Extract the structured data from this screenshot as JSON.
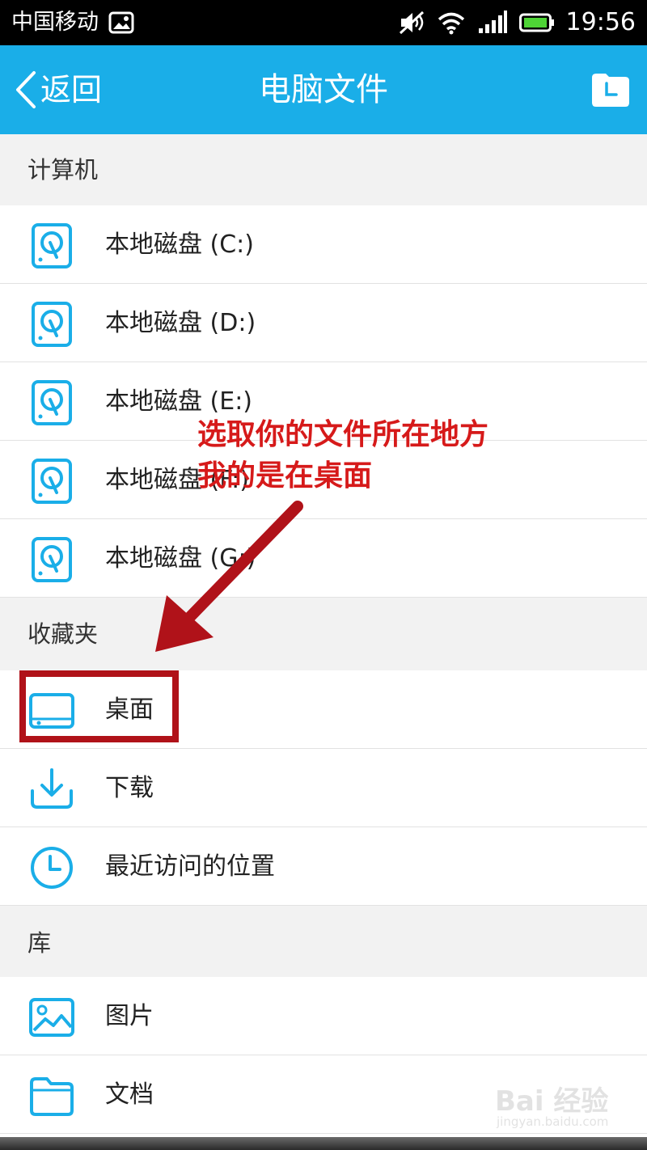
{
  "status_bar": {
    "carrier": "中国移动",
    "time": "19:56",
    "icons": [
      "image-notification-icon",
      "mute-icon",
      "wifi-icon",
      "signal-icon",
      "battery-icon"
    ]
  },
  "nav": {
    "back_label": "返回",
    "title": "电脑文件",
    "right_icon": "history-icon"
  },
  "sections": {
    "computer": {
      "header": "计算机",
      "items": [
        {
          "label": "本地磁盘 (C:)",
          "icon": "hard-disk-icon"
        },
        {
          "label": "本地磁盘 (D:)",
          "icon": "hard-disk-icon"
        },
        {
          "label": "本地磁盘 (E:)",
          "icon": "hard-disk-icon"
        },
        {
          "label": "本地磁盘 (F:)",
          "icon": "hard-disk-icon"
        },
        {
          "label": "本地磁盘 (G:)",
          "icon": "hard-disk-icon"
        }
      ]
    },
    "favorites": {
      "header": "收藏夹",
      "items": [
        {
          "label": "桌面",
          "icon": "desktop-icon"
        },
        {
          "label": "下载",
          "icon": "download-icon"
        },
        {
          "label": "最近访问的位置",
          "icon": "clock-icon"
        }
      ]
    },
    "library": {
      "header": "库",
      "items": [
        {
          "label": "图片",
          "icon": "picture-icon"
        },
        {
          "label": "文档",
          "icon": "folder-icon"
        }
      ]
    }
  },
  "annotation": {
    "line1": "选取你的文件所在地方",
    "line2": "我的是在桌面"
  },
  "watermark": {
    "brand": "Bai 经验",
    "url": "jingyan.baidu.com"
  },
  "colors": {
    "accent": "#1aaee8",
    "annotation_red": "#d61a1a",
    "box_red": "#b01219"
  }
}
